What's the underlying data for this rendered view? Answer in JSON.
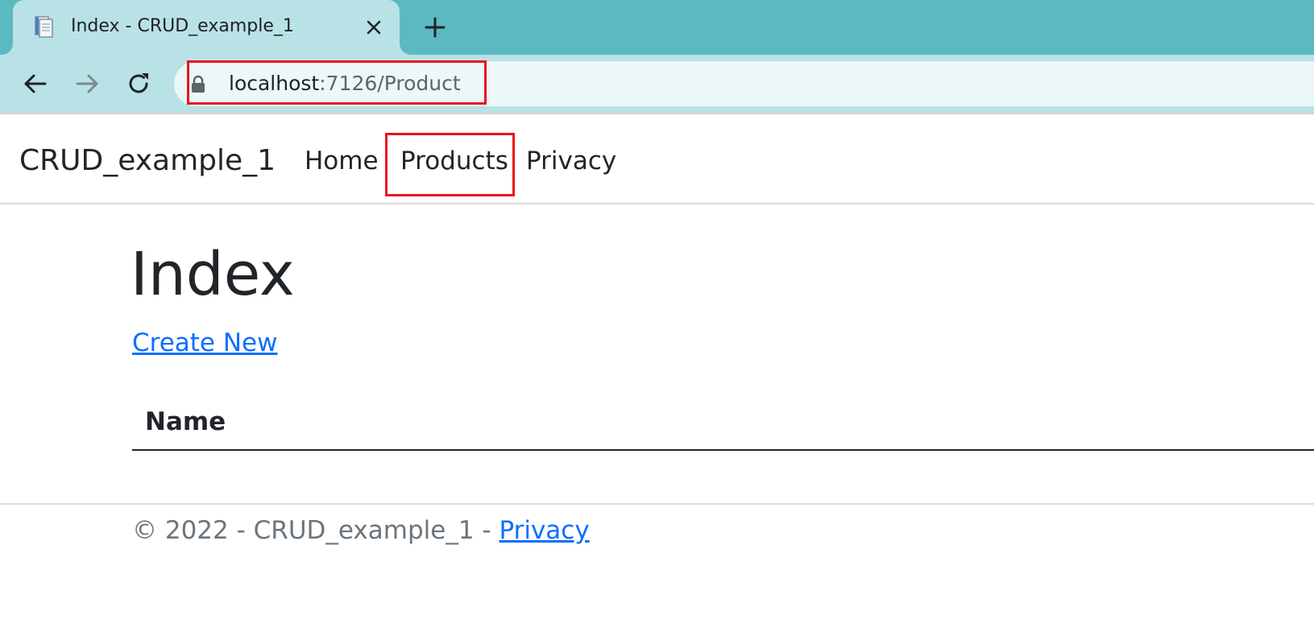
{
  "browser": {
    "tab": {
      "title": "Index - CRUD_example_1",
      "favicon": "document-favicon-icon",
      "close_icon": "close-icon"
    },
    "new_tab_icon": "plus-icon",
    "nav": {
      "back_icon": "arrow-left-icon",
      "forward_icon": "arrow-right-icon",
      "reload_icon": "reload-icon"
    },
    "address": {
      "lock_icon": "lock-icon",
      "host": "localhost",
      "rest": ":7126/Product"
    },
    "colors": {
      "tabstrip": "#5cb9c2",
      "active_tab": "#b8e2e6",
      "omnibox": "#ebf7f8",
      "annotation_red": "#e8141c"
    }
  },
  "navbar": {
    "brand": "CRUD_example_1",
    "links": [
      "Home",
      "Products",
      "Privacy"
    ]
  },
  "main": {
    "title": "Index",
    "create_link": "Create New",
    "table": {
      "headers": [
        "Name"
      ],
      "rows": []
    }
  },
  "footer": {
    "text": "© 2022 - CRUD_example_1 - ",
    "privacy_link": "Privacy"
  },
  "colors": {
    "link_blue": "#0d6efd",
    "text_dark": "#212529",
    "text_muted": "#6c757d"
  }
}
